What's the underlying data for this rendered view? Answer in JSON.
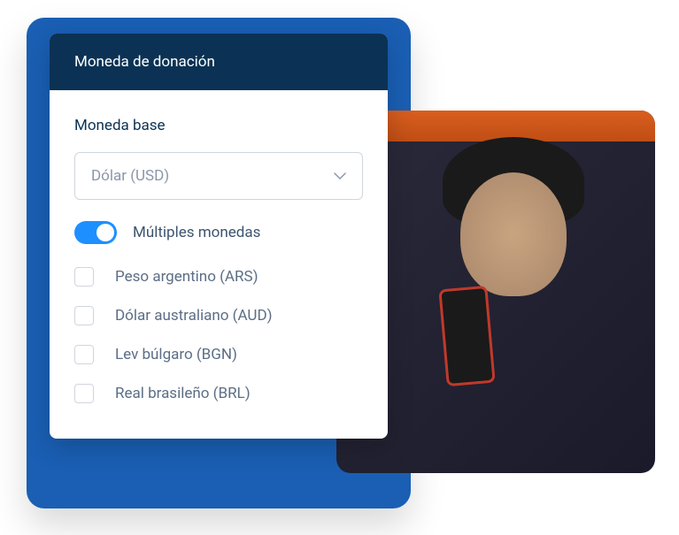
{
  "card": {
    "title": "Moneda de donación",
    "baseCurrencyLabel": "Moneda base",
    "selectedCurrency": "Dólar (USD)",
    "multipleCurrenciesLabel": "Múltiples monedas",
    "multipleCurrenciesEnabled": true,
    "currencies": [
      {
        "label": "Peso argentino (ARS)",
        "checked": false
      },
      {
        "label": "Dólar australiano (AUD)",
        "checked": false
      },
      {
        "label": "Lev búlgaro (BGN)",
        "checked": false
      },
      {
        "label": "Real brasileño (BRL)",
        "checked": false
      }
    ]
  }
}
